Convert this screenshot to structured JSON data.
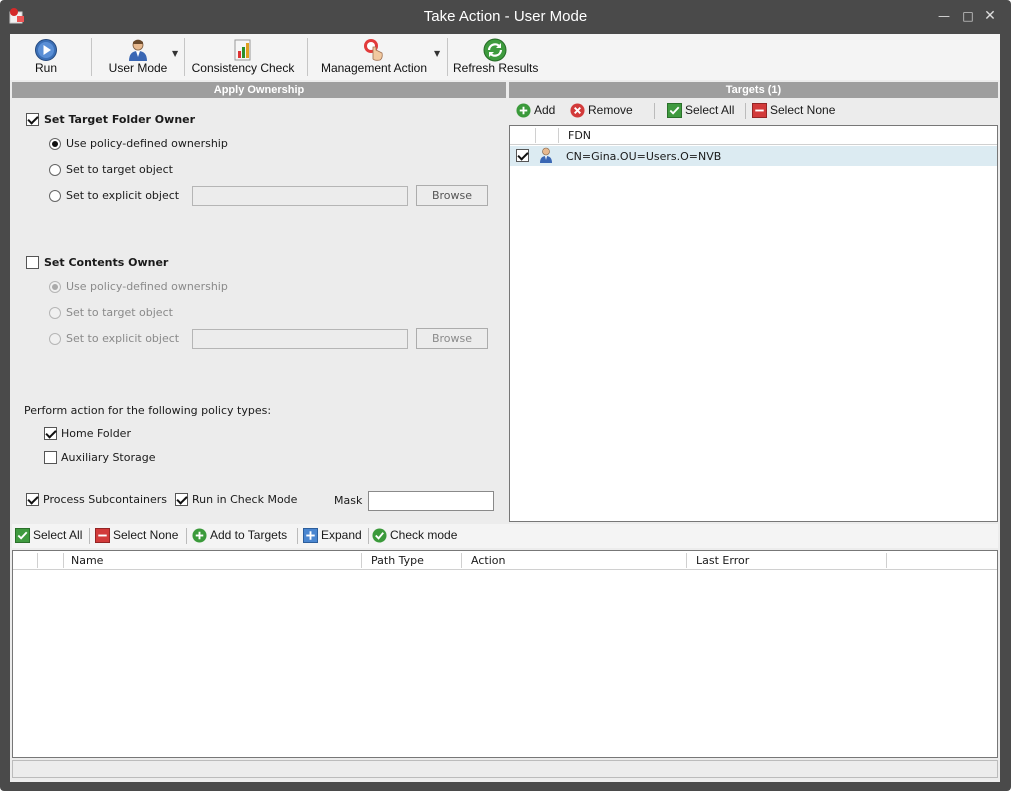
{
  "window": {
    "title": "Take Action - User Mode"
  },
  "toolbar": {
    "run": "Run",
    "user_mode": "User Mode",
    "consistency_check": "Consistency Check",
    "management_action": "Management Action",
    "refresh_results": "Refresh Results"
  },
  "apply_ownership": {
    "header": "Apply Ownership",
    "target_folder_owner": {
      "label": "Set Target Folder Owner",
      "checked": true,
      "opt_policy": "Use policy-defined ownership",
      "opt_target": "Set to target object",
      "opt_explicit": "Set to explicit object",
      "browse": "Browse"
    },
    "contents_owner": {
      "label": "Set Contents Owner",
      "checked": false,
      "opt_policy": "Use policy-defined ownership",
      "opt_target": "Set to target object",
      "opt_explicit": "Set to explicit object",
      "browse": "Browse"
    },
    "policy_types_label": "Perform action for the following policy types:",
    "home_folder": "Home Folder",
    "auxiliary_storage": "Auxiliary Storage",
    "process_subcontainers": "Process Subcontainers",
    "run_in_check_mode": "Run in Check Mode",
    "mask_label": "Mask",
    "mask_value": ""
  },
  "targets": {
    "header": "Targets  (1)",
    "add": "Add",
    "remove": "Remove",
    "select_all": "Select All",
    "select_none": "Select None",
    "col_fdn": "FDN",
    "rows": [
      {
        "fdn": "CN=Gina.OU=Users.O=NVB",
        "checked": true
      }
    ]
  },
  "results": {
    "select_all": "Select All",
    "select_none": "Select None",
    "add_to_targets": "Add to Targets",
    "expand": "Expand",
    "check_mode": "Check mode",
    "columns": {
      "name": "Name",
      "path_type": "Path Type",
      "action": "Action",
      "last_error": "Last Error"
    }
  }
}
